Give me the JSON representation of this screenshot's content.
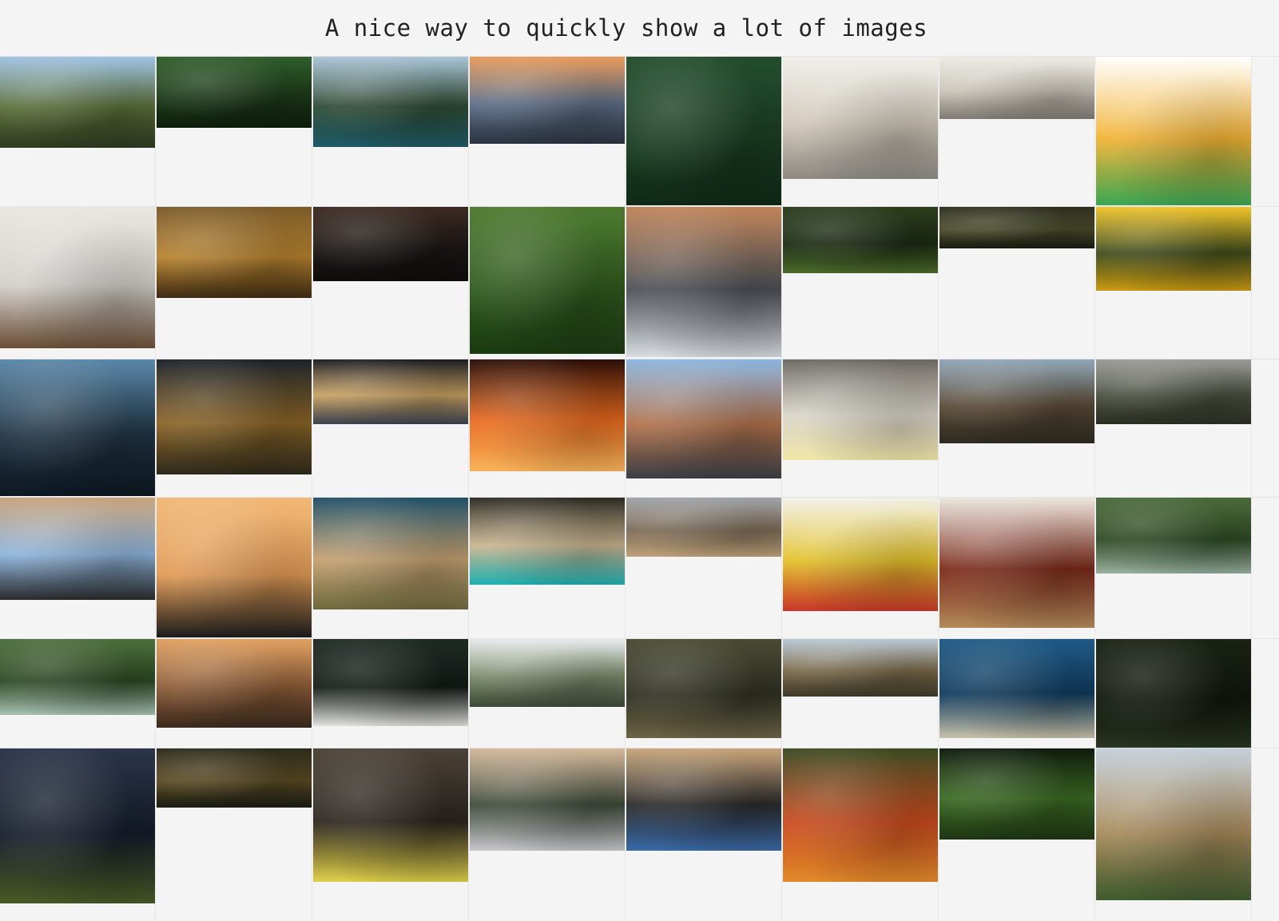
{
  "page": {
    "title": "A nice way to quickly show a lot of images"
  },
  "gallery": {
    "rows": [
      [
        {
          "name": "mountain-valley-road",
          "colors": [
            "#9fc3e3",
            "#5b6f3a",
            "#2e3a1f"
          ],
          "aspect": 0.59
        },
        {
          "name": "jungle-leaves",
          "colors": [
            "#2f5d2b",
            "#1c3b18",
            "#0e1f0c"
          ],
          "aspect": 0.46
        },
        {
          "name": "mountain-lake",
          "colors": [
            "#a9c4d6",
            "#2e4a34",
            "#1f5b66"
          ],
          "aspect": 0.58
        },
        {
          "name": "sunset-clouds-sea",
          "colors": [
            "#e89a5a",
            "#5a6d86",
            "#2c3440"
          ],
          "aspect": 0.56
        },
        {
          "name": "plane-over-forest",
          "colors": [
            "#234d2c",
            "#1a3e22",
            "#0f2a16"
          ],
          "aspect": 0.96
        },
        {
          "name": "office-lounge-lamp",
          "colors": [
            "#f0efea",
            "#cfc7b8",
            "#8e8a83"
          ],
          "aspect": 0.79
        },
        {
          "name": "office-lounge-wide",
          "colors": [
            "#eceae4",
            "#c9c3b6",
            "#7f7b74"
          ],
          "aspect": 0.4
        },
        {
          "name": "gummy-worms",
          "colors": [
            "#ffffff",
            "#f2b233",
            "#3aa655"
          ],
          "aspect": 0.96
        }
      ],
      [
        {
          "name": "dining-room-desk",
          "colors": [
            "#e9e6e1",
            "#d3d0cb",
            "#6b4f36"
          ],
          "aspect": 0.91
        },
        {
          "name": "autumn-larch-forest",
          "colors": [
            "#7a5a2a",
            "#b7822e",
            "#3e2c14"
          ],
          "aspect": 0.59
        },
        {
          "name": "bedroom-lamp-night",
          "colors": [
            "#3b2a22",
            "#1c1714",
            "#0f0d0c"
          ],
          "aspect": 0.48
        },
        {
          "name": "aerial-palm-terraces",
          "colors": [
            "#4d7a2f",
            "#2f5a1e",
            "#1a3b12"
          ],
          "aspect": 0.95
        },
        {
          "name": "mountain-cabin-snow",
          "colors": [
            "#c0845a",
            "#4b4f55",
            "#d8dde2"
          ],
          "aspect": 0.97
        },
        {
          "name": "forest-waterfall",
          "colors": [
            "#2b3d1c",
            "#1b2a12",
            "#4a6b2a"
          ],
          "aspect": 0.43
        },
        {
          "name": "mossy-rocks",
          "colors": [
            "#2c2f1e",
            "#4a4a2a",
            "#1a1c12"
          ],
          "aspect": 0.27
        },
        {
          "name": "sunflower-field",
          "colors": [
            "#f0c428",
            "#3e4a1c",
            "#c99a12"
          ],
          "aspect": 0.54
        }
      ],
      [
        {
          "name": "misty-mountain-peaks",
          "colors": [
            "#5a87a8",
            "#203444",
            "#0d1822"
          ],
          "aspect": 0.88
        },
        {
          "name": "glowing-tree-night",
          "colors": [
            "#1c222a",
            "#8a6426",
            "#2e2a1c"
          ],
          "aspect": 0.74
        },
        {
          "name": "city-bridge-night",
          "colors": [
            "#1a1c22",
            "#c7a060",
            "#3b4250"
          ],
          "aspect": 0.42
        },
        {
          "name": "campfire-flames",
          "colors": [
            "#2a0e08",
            "#e86a1e",
            "#f7b45a"
          ],
          "aspect": 0.72
        },
        {
          "name": "hotel-building",
          "colors": [
            "#8bb5de",
            "#b0704a",
            "#3b3f46"
          ],
          "aspect": 0.77
        },
        {
          "name": "coffee-table-plant",
          "colors": [
            "#6a6660",
            "#d8d4c8",
            "#f0e6a8"
          ],
          "aspect": 0.65
        },
        {
          "name": "mountain-sunrise-valley",
          "colors": [
            "#8fa6b8",
            "#5a4a36",
            "#2e2a20"
          ],
          "aspect": 0.54
        },
        {
          "name": "foggy-ridge",
          "colors": [
            "#9a9a96",
            "#4b5040",
            "#2c3024"
          ],
          "aspect": 0.42
        }
      ],
      [
        {
          "name": "tablet-on-desk",
          "colors": [
            "#c8a27a",
            "#8eb4dc",
            "#2a2a2c"
          ],
          "aspect": 0.66
        },
        {
          "name": "power-pylon-sunset",
          "colors": [
            "#f0b876",
            "#e09a54",
            "#1c1c1c"
          ],
          "aspect": 0.9
        },
        {
          "name": "desert-hills",
          "colors": [
            "#1f4f66",
            "#c4a070",
            "#6e6a3e"
          ],
          "aspect": 0.72
        },
        {
          "name": "aerial-beach-forest",
          "colors": [
            "#2b2a22",
            "#c9b48e",
            "#1fb0b2"
          ],
          "aspect": 0.56
        },
        {
          "name": "elephant-herd",
          "colors": [
            "#9ea2a6",
            "#7b6a56",
            "#c0a27a"
          ],
          "aspect": 0.38
        },
        {
          "name": "graffiti-wall",
          "colors": [
            "#f2f0ea",
            "#e2c22a",
            "#c8362a"
          ],
          "aspect": 0.73
        },
        {
          "name": "pie-on-table",
          "colors": [
            "#ece6de",
            "#7a2a1a",
            "#b48a5a"
          ],
          "aspect": 0.84
        },
        {
          "name": "greenhouse-plants",
          "colors": [
            "#4a6a3a",
            "#2c4a22",
            "#9ab0a0"
          ],
          "aspect": 0.49
        }
      ],
      [
        {
          "name": "greenhouse-pond",
          "colors": [
            "#4c6e3c",
            "#2a4822",
            "#a8c0b2"
          ],
          "aspect": 0.49
        },
        {
          "name": "rock-arch-sunset",
          "colors": [
            "#e0a060",
            "#8a5a36",
            "#3a2a1e"
          ],
          "aspect": 0.57
        },
        {
          "name": "house-in-dark-forest",
          "colors": [
            "#1e2a22",
            "#121a14",
            "#e2e2e0"
          ],
          "aspect": 0.56
        },
        {
          "name": "snowy-plateau",
          "colors": [
            "#e8ebee",
            "#7a8a6a",
            "#3e4a36"
          ],
          "aspect": 0.44
        },
        {
          "name": "fallen-tree-forest",
          "colors": [
            "#4a4a32",
            "#2e3020",
            "#6c6446"
          ],
          "aspect": 0.64
        },
        {
          "name": "coastal-path",
          "colors": [
            "#b8c8d4",
            "#7a6a4a",
            "#3e3a2a"
          ],
          "aspect": 0.37
        },
        {
          "name": "aerial-islands",
          "colors": [
            "#1f5a86",
            "#0f3a5c",
            "#c8c2aa"
          ],
          "aspect": 0.64
        },
        {
          "name": "dark-forest-aerial",
          "colors": [
            "#1a2214",
            "#0f160c",
            "#2a3420"
          ],
          "aspect": 0.7
        }
      ],
      [
        {
          "name": "milky-way-field",
          "colors": [
            "#2a3448",
            "#141c2a",
            "#4a5a26"
          ],
          "aspect": 1.0
        },
        {
          "name": "tree-tunnel-road",
          "colors": [
            "#2a2a1a",
            "#5a4a22",
            "#1a1c12"
          ],
          "aspect": 0.38
        },
        {
          "name": "blue-tit-bird",
          "colors": [
            "#4a4236",
            "#2a241e",
            "#e0d04a"
          ],
          "aspect": 0.86
        },
        {
          "name": "laptop-in-bag",
          "colors": [
            "#d4b89a",
            "#3e4a3a",
            "#c8c8cc"
          ],
          "aspect": 0.66
        },
        {
          "name": "person-with-laptop",
          "colors": [
            "#c8a47a",
            "#2a2a2a",
            "#3a6aa8"
          ],
          "aspect": 0.66
        },
        {
          "name": "autumn-forest-aerial",
          "colors": [
            "#3a4a22",
            "#c84a1e",
            "#e28a2a"
          ],
          "aspect": 0.86
        },
        {
          "name": "pine-needles",
          "colors": [
            "#0f1a0c",
            "#3a6a22",
            "#1e3614"
          ],
          "aspect": 0.59
        },
        {
          "name": "colorful-mountains",
          "colors": [
            "#c4d0da",
            "#a88a5a",
            "#3e5a2e"
          ],
          "aspect": 0.98
        }
      ]
    ]
  }
}
